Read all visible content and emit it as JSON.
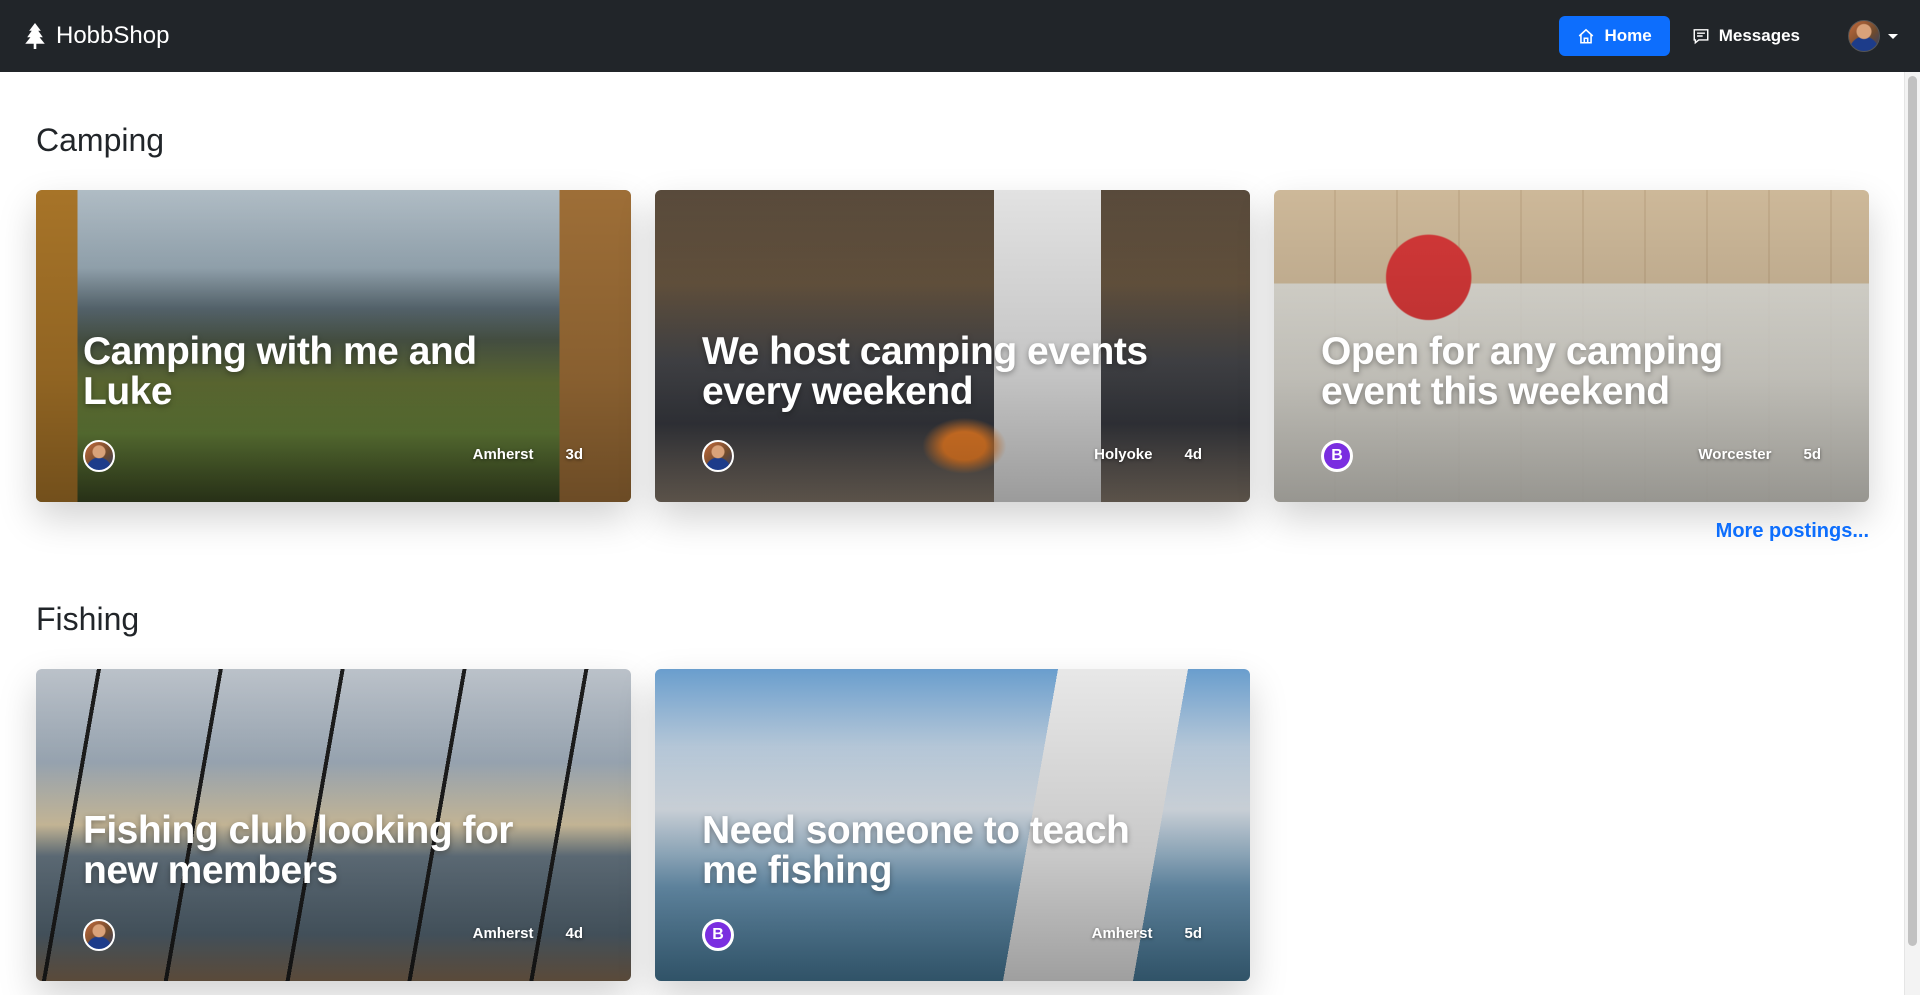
{
  "navbar": {
    "brand": "HobbShop",
    "brand_icon": "tree-icon",
    "home_label": "Home",
    "messages_label": "Messages"
  },
  "sections": [
    {
      "title": "Camping",
      "more_label": "More postings...",
      "cards": [
        {
          "title": "Camping with me and Luke",
          "location": "Amherst",
          "age": "3d",
          "avatar": "user-photo"
        },
        {
          "title": "We host camping events every weekend",
          "location": "Holyoke",
          "age": "4d",
          "avatar": "user-photo"
        },
        {
          "title": "Open for any camping event this weekend",
          "location": "Worcester",
          "age": "5d",
          "avatar": "bootstrap-logo"
        }
      ]
    },
    {
      "title": "Fishing",
      "cards": [
        {
          "title": "Fishing club looking for new members",
          "location": "Amherst",
          "age": "4d",
          "avatar": "user-photo"
        },
        {
          "title": "Need someone to teach me fishing",
          "location": "Amherst",
          "age": "5d",
          "avatar": "bootstrap-logo"
        }
      ]
    }
  ],
  "colors": {
    "navbar": "#212529",
    "primary": "#0d6efd",
    "bootstrap_purple": "#7a2ee0"
  }
}
